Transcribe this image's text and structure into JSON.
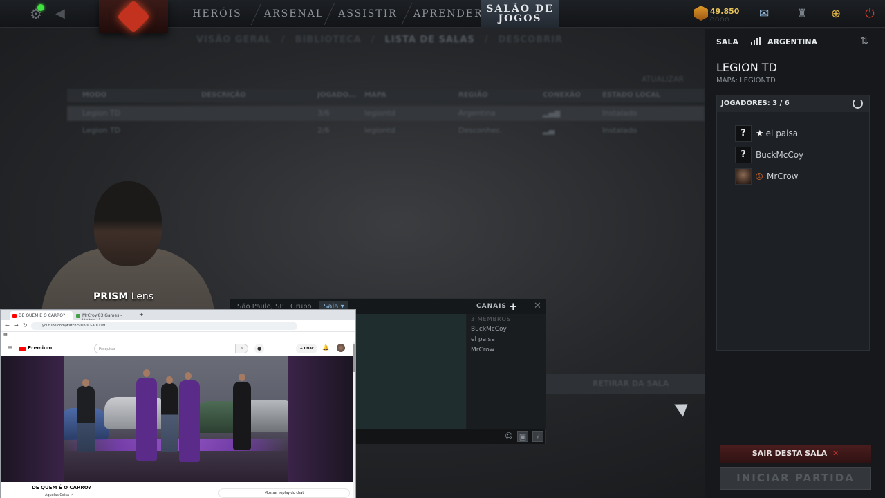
{
  "topnav": {
    "tabs": [
      "HERÓIS",
      "ARSENAL",
      "ASSISTIR",
      "APRENDER"
    ],
    "active_tab_line1": "SALÃO DE",
    "active_tab_line2": "JOGOS",
    "gold": "49.850",
    "gold_dots": "○○○○",
    "icons": [
      "settings-gear-icon",
      "back-arrow-icon",
      "chat-icon",
      "armory-icon",
      "plus-icon",
      "power-icon"
    ]
  },
  "subnav": [
    "VISÃO GERAL",
    "/",
    "BIBLIOTECA",
    "/",
    "LISTA DE SALAS",
    "/",
    "DESCOBRIR"
  ],
  "lobby_list": {
    "update": "ATUALIZAR",
    "headers": [
      "MODO",
      "DESCRIÇÃO",
      "JOGADO...",
      "MAPA",
      "REGIÃO",
      "CONEXÃO",
      "ESTADO LOCAL"
    ],
    "rows": [
      [
        "Legion TD",
        "",
        "3/6",
        "legiontd",
        "Argentina",
        "",
        "Instalado"
      ],
      [
        "Legion TD",
        "",
        "2/6",
        "legiontd",
        "Desconhec.",
        "",
        "Instalado"
      ]
    ]
  },
  "lobby": {
    "label": "SALA",
    "region": "ARGENTINA",
    "title": "LEGION TD",
    "map": "MAPA: LEGIONTD",
    "players_header": "JOGADORES: 3 / 6",
    "players": [
      {
        "name": "el paisa",
        "avatar": "?",
        "host": true
      },
      {
        "name": "BuckMcCoy",
        "avatar": "?",
        "host": false
      },
      {
        "name": "MrCrow",
        "avatar": "",
        "host": false
      }
    ],
    "leave_button": "SAIR DESTA SALA",
    "leave_x": "✕",
    "start_button": "INICIAR PARTIDA"
  },
  "webcam": {
    "brand": "PRISM",
    "suffix": " Lens"
  },
  "chat": {
    "tabs": [
      "São Paulo, SP",
      "Grupo",
      "Sala"
    ],
    "channels_label": "CANAIS",
    "members_count": "3 MEMBROS",
    "members": [
      "BuckMcCoy",
      "el paisa",
      "MrCrow"
    ],
    "below_button": "RETIRAR DA SALA"
  },
  "browser": {
    "tabs": [
      "DE QUEM É O CARRO?",
      "MrCrow83 Games - Watch Li..."
    ],
    "url": "youtube.com/watch?v=h-sD-aULTzM",
    "search_placeholder": "Pesquisar",
    "logo_text": "Premium",
    "create_label": "+ Criar",
    "video_title": "DE QUEM É O CARRO?",
    "channel": "Aquelas Coisa ✓",
    "chat_replay": "Mostrar replay do chat"
  },
  "colors": {
    "accent_gold": "#e8c35a",
    "online": "#3fe23f",
    "leave_bg": "#4a1d1d",
    "power": "#d23a2c"
  }
}
